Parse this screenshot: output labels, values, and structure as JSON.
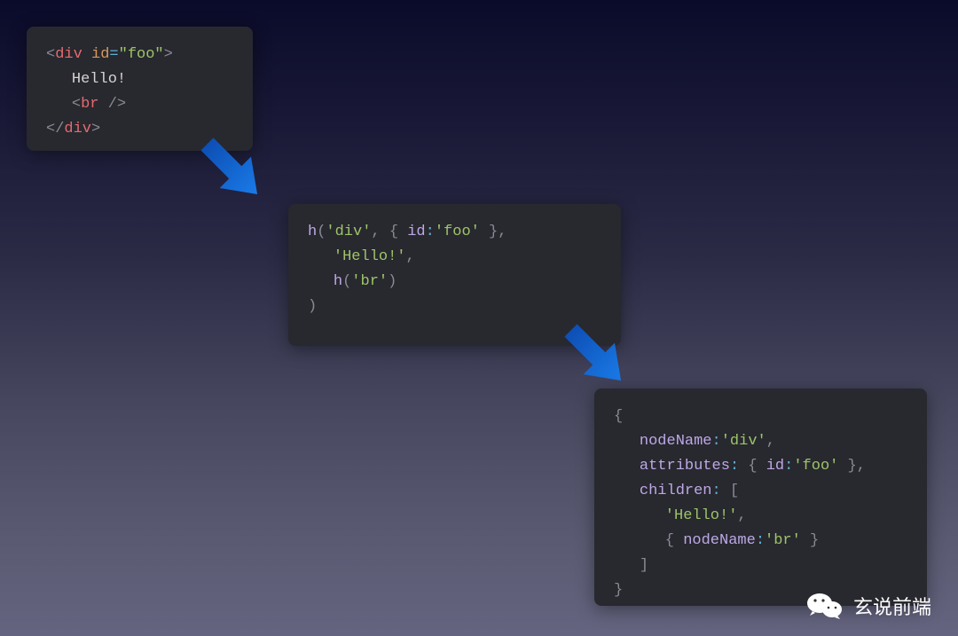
{
  "box1": {
    "l1_open": "<",
    "l1_tag": "div",
    "l1_sp": " ",
    "l1_attr": "id",
    "l1_eq": "=",
    "l1_str": "\"foo\"",
    "l1_close": ">",
    "l2_text": "Hello!",
    "l3_open": "<",
    "l3_tag": "br",
    "l3_sl": " /",
    "l3_close": ">",
    "l4_open": "</",
    "l4_tag": "div",
    "l4_close": ">"
  },
  "box2": {
    "l1_fn": "h",
    "l1_p1": "(",
    "l1_s1": "'div'",
    "l1_c1": ", ",
    "l1_b1": "{ ",
    "l1_k1": "id",
    "l1_col": ":",
    "l1_v1": "'foo'",
    "l1_b2": " }",
    "l1_c2": ",",
    "l2_s": "'Hello!'",
    "l2_c": ",",
    "l3_fn": "h",
    "l3_p1": "(",
    "l3_s": "'br'",
    "l3_p2": ")",
    "l4_p": ")"
  },
  "box3": {
    "l1_b": "{",
    "l2_k": "nodeName",
    "l2_col": ":",
    "l2_v": "'div'",
    "l2_c": ",",
    "l3_k": "attributes",
    "l3_col": ": ",
    "l3_b1": "{ ",
    "l3_k2": "id",
    "l3_col2": ":",
    "l3_v": "'foo'",
    "l3_b2": " }",
    "l3_c": ",",
    "l4_k": "children",
    "l4_col": ": ",
    "l4_b": "[",
    "l5_v": "'Hello!'",
    "l5_c": ",",
    "l6_b1": "{ ",
    "l6_k": "nodeName",
    "l6_col": ":",
    "l6_v": "'br'",
    "l6_b2": " }",
    "l7_b": "]",
    "l8_b": "}"
  },
  "footer": {
    "text": "玄说前端"
  },
  "colors": {
    "arrow": "#1165d9"
  }
}
